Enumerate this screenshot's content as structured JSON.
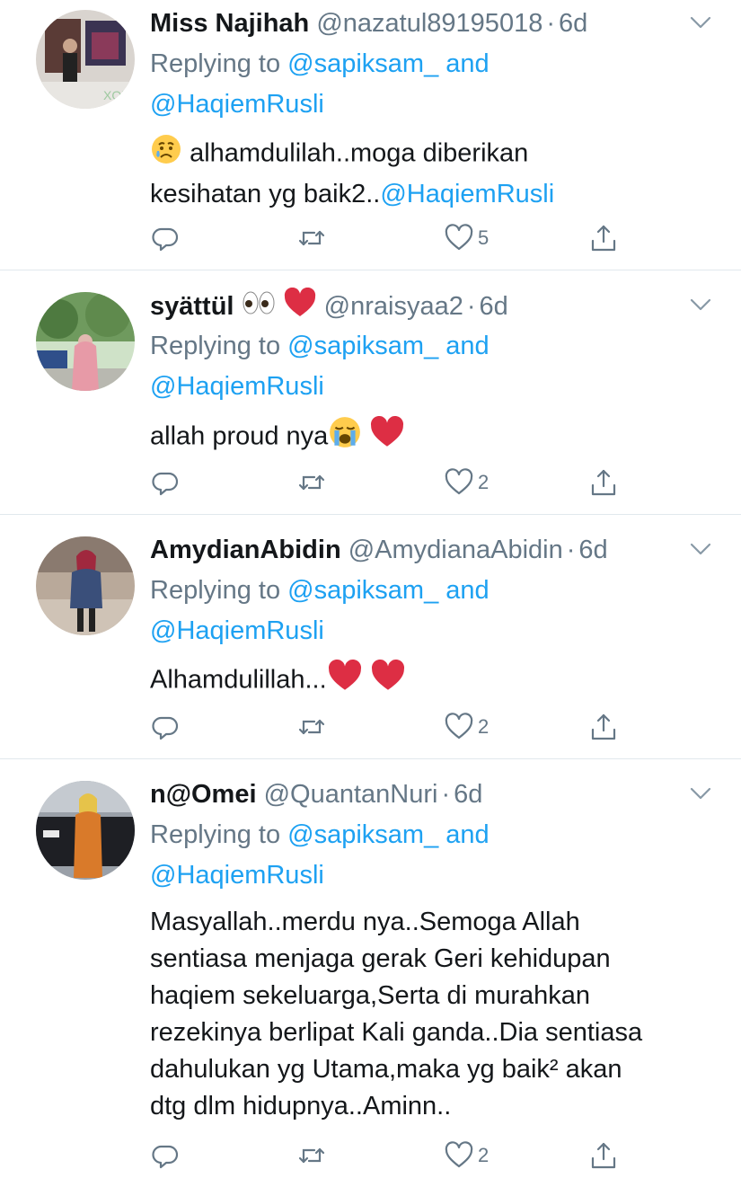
{
  "tweets": [
    {
      "name": "Miss Najihah",
      "name_emojis": [],
      "handle": "@nazatul89195018",
      "separator": "·",
      "time": "6d",
      "replying_prefix": "Replying to",
      "replying_user1": "@sapiksam_",
      "replying_and": "and",
      "replying_user2": "@HaqiemRusli",
      "body_line1": "alhamdulilah..moga diberikan",
      "body_line2_text": "kesihatan yg baik2..",
      "body_line2_mention": "@HaqiemRusli",
      "like_count": "5"
    },
    {
      "name": "syättül",
      "name_emojis": [
        "eyes-emoji",
        "red-heart-emoji"
      ],
      "handle": "@nraisyaa2",
      "separator": "·",
      "time": "6d",
      "replying_prefix": "Replying to",
      "replying_user1": "@sapiksam_",
      "replying_and": "and",
      "replying_user2": "@HaqiemRusli",
      "body_line1": "allah proud nya",
      "like_count": "2"
    },
    {
      "name": "AmydianAbidin",
      "name_emojis": [],
      "handle": "@AmydianaAbidin",
      "separator": "·",
      "time": "6d",
      "replying_prefix": "Replying to",
      "replying_user1": "@sapiksam_",
      "replying_and": "and",
      "replying_user2": "@HaqiemRusli",
      "body_line1": "Alhamdulillah...",
      "like_count": "2"
    },
    {
      "name": "n@Omei",
      "name_emojis": [],
      "handle": "@QuantanNuri",
      "separator": "·",
      "time": "6d",
      "replying_prefix": "Replying to",
      "replying_user1": "@sapiksam_",
      "replying_and": "and",
      "replying_user2": "@HaqiemRusli",
      "body_lines": [
        "Masyallah..merdu nya..Semoga Allah",
        "sentiasa menjaga gerak Geri kehidupan",
        "haqiem sekeluarga,Serta di murahkan",
        "rezekinya berlipat Kali ganda..Dia sentiasa",
        "dahulukan yg Utama,maka yg baik² akan",
        "dtg dlm hidupnya..Aminn.."
      ],
      "like_count": "2"
    }
  ],
  "icons": {
    "reply": "reply-icon",
    "retweet": "retweet-icon",
    "like": "heart-icon",
    "share": "share-icon",
    "more": "chevron-down-icon"
  },
  "colors": {
    "accent": "#1da1f2",
    "secondary_text": "#657786",
    "divider": "#e1e8ed"
  }
}
